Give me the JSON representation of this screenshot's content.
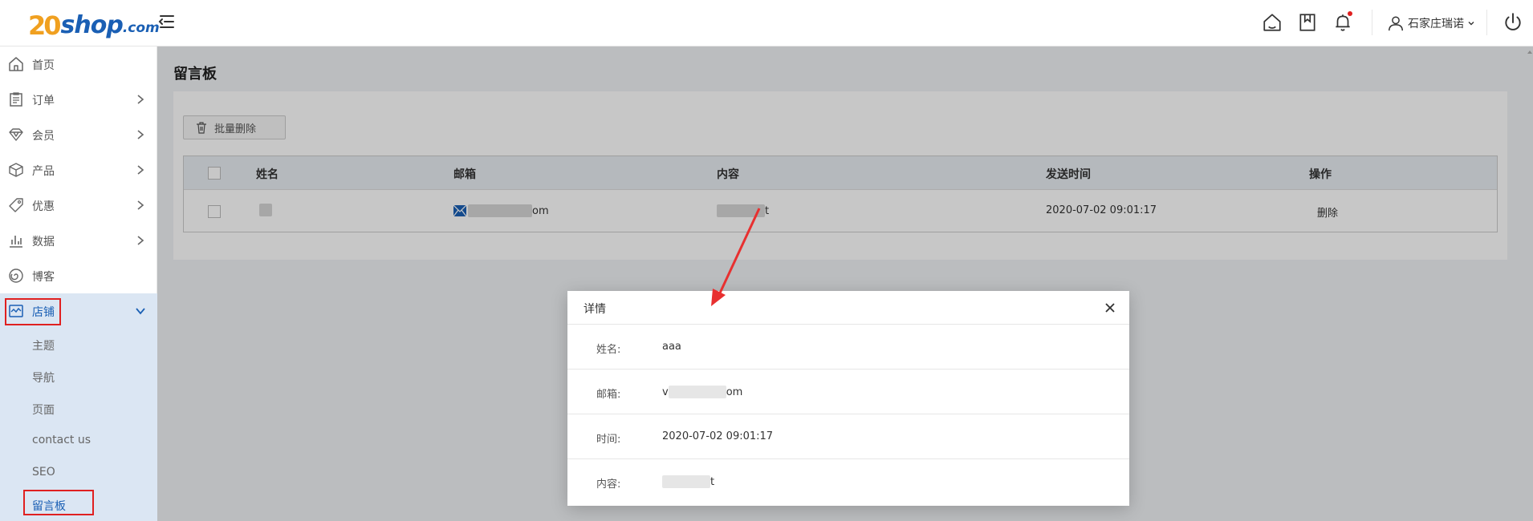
{
  "brand": {
    "logo_number": "20",
    "logo_word": "shop",
    "logo_tld": ".com"
  },
  "header": {
    "icons": [
      "home-icon",
      "bookmark-icon",
      "bell-icon",
      "user-icon",
      "power-icon"
    ],
    "user_name": "石家庄瑞诺",
    "notification_dot_color": "#e02020"
  },
  "sidebar": {
    "items": [
      {
        "label": "首页",
        "icon": "home-icon"
      },
      {
        "label": "订单",
        "icon": "clipboard-icon"
      },
      {
        "label": "会员",
        "icon": "diamond-icon"
      },
      {
        "label": "产品",
        "icon": "box-icon"
      },
      {
        "label": "优惠",
        "icon": "tag-icon"
      },
      {
        "label": "数据",
        "icon": "bar-chart-icon"
      },
      {
        "label": "博客",
        "icon": "spiral-icon"
      },
      {
        "label": "店铺",
        "icon": "store-icon"
      }
    ],
    "subitems": [
      "主题",
      "导航",
      "页面",
      "contact us",
      "SEO",
      "留言板"
    ],
    "active_color": "#1a5fb4"
  },
  "page": {
    "title": "留言板",
    "batch_delete": "批量删除",
    "table": {
      "headers": [
        "姓名",
        "邮箱",
        "内容",
        "发送时间",
        "操作"
      ],
      "rows": [
        {
          "email_visible": "om",
          "content_visible": "t",
          "time": "2020-07-02 09:01:17",
          "action": "删除"
        }
      ]
    }
  },
  "dialog": {
    "title": "详情",
    "fields": [
      {
        "key": "姓名:",
        "value": "aaa"
      },
      {
        "key": "邮箱:",
        "value_prefix": "v",
        "value_suffix": "om"
      },
      {
        "key": "时间:",
        "value": "2020-07-02 09:01:17"
      },
      {
        "key": "内容:",
        "value_prefix": "",
        "value_suffix": "t"
      }
    ]
  }
}
